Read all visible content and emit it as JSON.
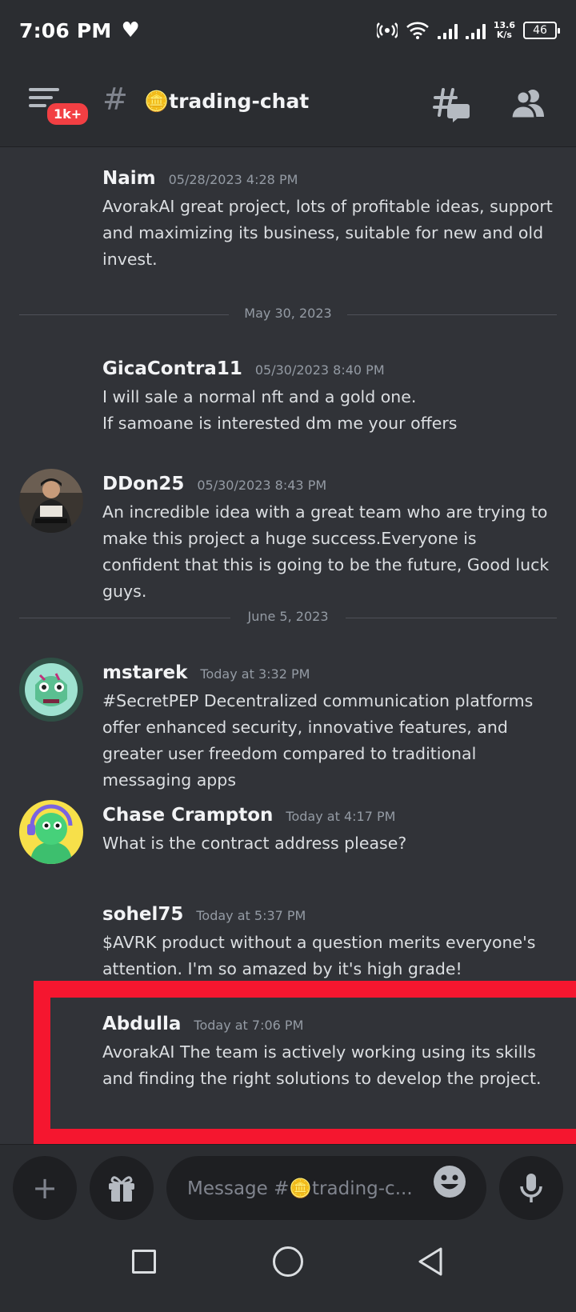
{
  "status_bar": {
    "time": "7:06 PM",
    "speed_top": "13.6",
    "speed_bottom": "K/s",
    "battery": "46",
    "icons": [
      "heart-icon",
      "hotspot-icon",
      "wifi-icon",
      "signal-icon",
      "battery-icon"
    ]
  },
  "header": {
    "badge": "1k+",
    "channel_emoji": "🪙",
    "channel_name": "trading-chat",
    "icons": [
      "menu-icon",
      "hash-icon",
      "threads-icon",
      "members-icon"
    ]
  },
  "messages": [
    {
      "author": "Naim",
      "timestamp": "05/28/2023 4:28 PM",
      "text": "AvorakAI great project, lots of profitable ideas, support and maximizing its business, suitable for new and old invest."
    },
    {
      "author": "GicaContra11",
      "timestamp": "05/30/2023 8:40 PM",
      "line1": "I will sale a normal nft and a gold one.",
      "line2": "If samoane is interested dm me your offers"
    },
    {
      "author": "DDon25",
      "timestamp": "05/30/2023 8:43 PM",
      "text": "An incredible idea with a great team who are trying to make this project a huge success.Everyone is confident that this is going to be the future, Good luck guys."
    },
    {
      "author": "mstarek",
      "timestamp": "Today at 3:32 PM",
      "text": "#SecretPEP Decentralized communication platforms offer enhanced security, innovative features, and greater user freedom compared to traditional messaging apps"
    },
    {
      "author": "Chase Crampton",
      "timestamp": "Today at 4:17 PM",
      "text": "What is the contract address please?"
    },
    {
      "author": "sohel75",
      "timestamp": "Today at 5:37 PM",
      "text": "$AVRK product without a question merits everyone's attention. I'm so amazed by it's high grade!"
    },
    {
      "author": "Abdulla",
      "timestamp": "Today at 7:06 PM",
      "text": "AvorakAI The team is actively working using its skills and finding the right solutions to develop the project."
    }
  ],
  "dividers": [
    "May 30, 2023",
    "June 5, 2023"
  ],
  "composer": {
    "placeholder": "Message #🪙trading-c...",
    "icons": [
      "plus-icon",
      "gift-icon",
      "emoji-icon",
      "mic-icon"
    ]
  },
  "colors": {
    "background": "#313338",
    "header": "#2b2d31",
    "highlight": "#f5162f",
    "badge": "#f23f43"
  }
}
